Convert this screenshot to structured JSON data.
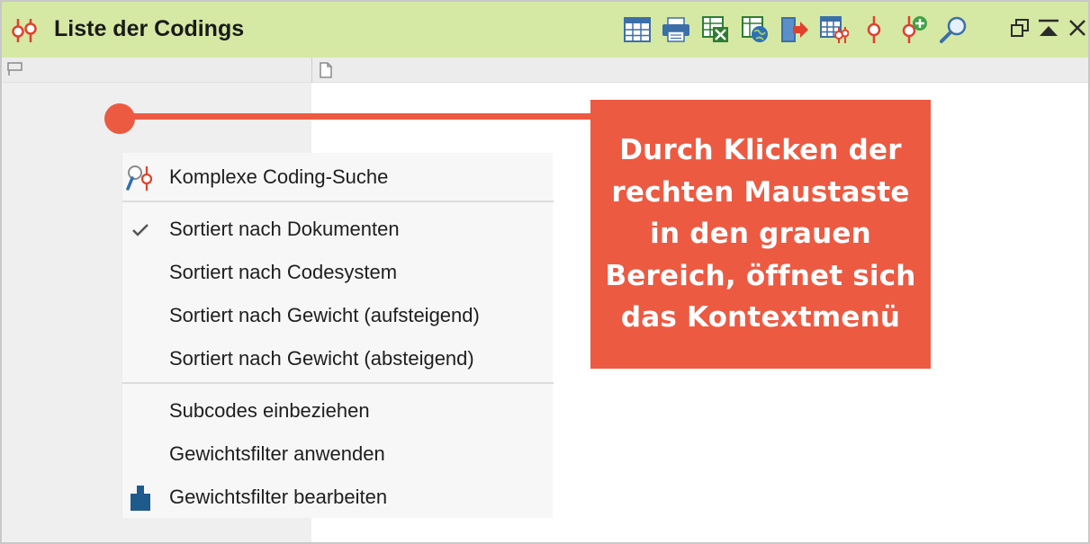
{
  "window": {
    "title": "Liste der Codings",
    "title_icon": "coding-list-icon",
    "toolbar": [
      {
        "name": "table-view-icon"
      },
      {
        "name": "print-icon"
      },
      {
        "name": "excel-export-icon"
      },
      {
        "name": "html-export-icon"
      },
      {
        "name": "export-icon"
      },
      {
        "name": "table-codings-icon"
      },
      {
        "name": "coding-icon"
      },
      {
        "name": "add-coding-icon"
      },
      {
        "name": "search-icon"
      }
    ],
    "window_controls": [
      "restore-icon",
      "minimize-icon",
      "close-icon"
    ]
  },
  "column_header": {
    "left_icon": "code-column-icon",
    "right_icon": "document-column-icon"
  },
  "context_menu": {
    "items": [
      {
        "label": "Komplexe Coding-Suche",
        "icon": "complex-search-icon",
        "checked": false
      },
      {
        "label": "Sortiert nach Dokumenten",
        "icon": "checkmark-icon",
        "checked": true
      },
      {
        "label": "Sortiert nach Codesystem",
        "icon": "",
        "checked": false
      },
      {
        "label": "Sortiert nach Gewicht (aufsteigend)",
        "icon": "",
        "checked": false
      },
      {
        "label": "Sortiert nach Gewicht (absteigend)",
        "icon": "",
        "checked": false
      },
      {
        "label": "Subcodes einbeziehen",
        "icon": "",
        "checked": false
      },
      {
        "label": "Gewichtsfilter anwenden",
        "icon": "",
        "checked": false
      },
      {
        "label": "Gewichtsfilter bearbeiten",
        "icon": "weight-icon",
        "checked": false
      }
    ]
  },
  "callout": {
    "text": "Durch Klicken der rechten Maustaste in den grauen Bereich, öffnet sich das Kontextmenü",
    "color": "#ec5a42"
  },
  "colors": {
    "titlebar": "#d5e8a4",
    "accent": "#ec5a42",
    "icon_blue": "#1f5a8c"
  }
}
